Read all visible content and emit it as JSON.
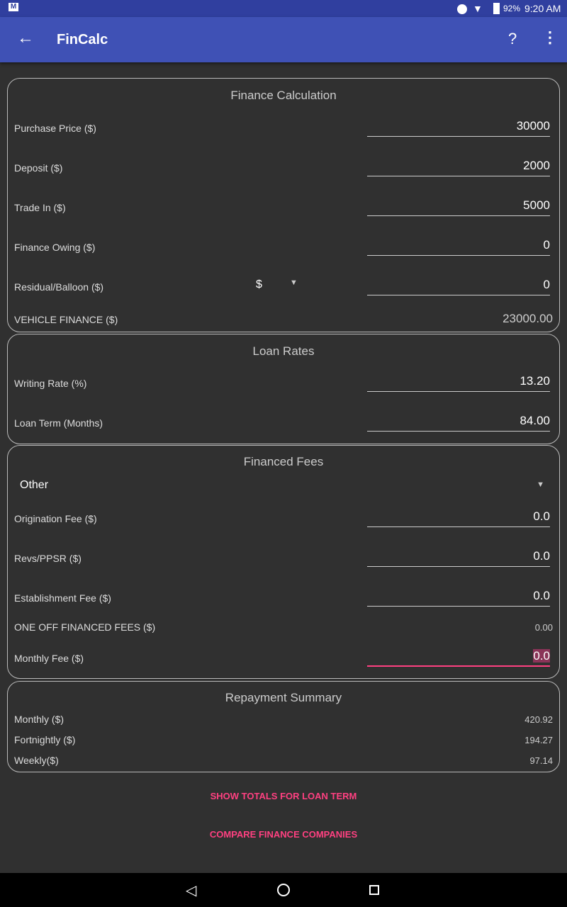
{
  "status_bar": {
    "battery": "92%",
    "time": "9:20 AM",
    "icons": [
      "gmail-icon",
      "do-not-disturb-icon",
      "wifi-icon",
      "battery-icon"
    ]
  },
  "toolbar": {
    "title": "FinCalc",
    "back_icon": "arrow-back-icon",
    "help_icon": "help-icon",
    "menu_icon": "more-vert-icon"
  },
  "finance": {
    "title": "Finance Calculation",
    "purchase_label": "Purchase Price ($)",
    "purchase": "30000",
    "deposit_label": "Deposit ($)",
    "deposit": "2000",
    "tradein_label": "Trade In ($)",
    "tradein": "5000",
    "owing_label": "Finance Owing ($)",
    "owing": "0",
    "residual_label": "Residual/Balloon ($)",
    "residual_type": "$",
    "residual": "0",
    "vehicle_label": "VEHICLE FINANCE ($)",
    "vehicle": "23000.00"
  },
  "rates": {
    "title": "Loan Rates",
    "rate_label": "Writing Rate (%)",
    "rate": "13.20",
    "term_label": "Loan Term (Months)",
    "term": "84.00"
  },
  "fees": {
    "title": "Financed Fees",
    "type": "Other",
    "orig_label": "Origination Fee ($)",
    "orig": "0.0",
    "revs_label": "Revs/PPSR ($)",
    "revs": "0.0",
    "est_label": "Establishment Fee ($)",
    "est": "0.0",
    "oneoff_label": "ONE OFF FINANCED FEES ($)",
    "oneoff": "0.00",
    "monthly_label": "Monthly Fee ($)",
    "monthly": "0.0"
  },
  "summary": {
    "title": "Repayment Summary",
    "monthly_label": "Monthly ($)",
    "monthly": "420.92",
    "fortnightly_label": "Fortnightly ($)",
    "fortnightly": "194.27",
    "weekly_label": "Weekly($)",
    "weekly": "97.14"
  },
  "actions": {
    "totals": "SHOW TOTALS FOR LOAN TERM",
    "compare": "COMPARE FINANCE COMPANIES"
  },
  "colors": {
    "primary": "#3f51b5",
    "primary_dark": "#303f9f",
    "accent": "#ff4081",
    "background": "#303030"
  }
}
